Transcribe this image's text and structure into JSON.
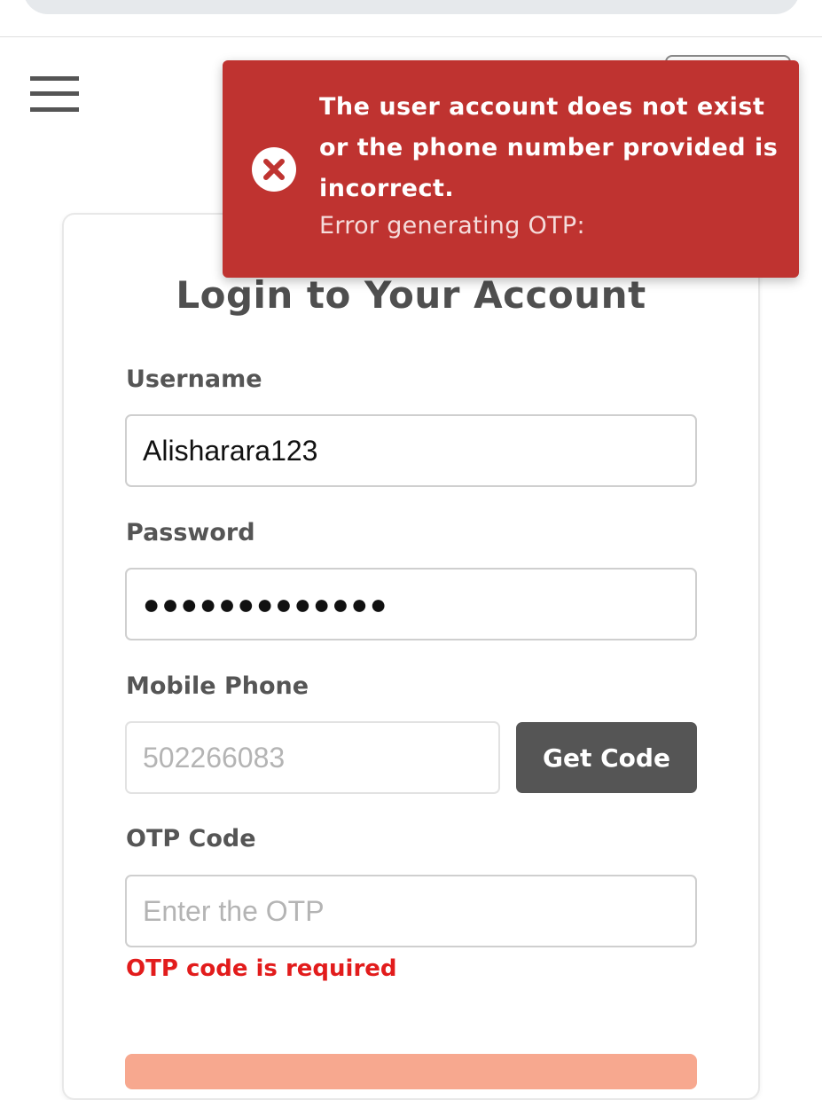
{
  "header": {
    "menu_icon": "hamburger-menu-icon"
  },
  "toast": {
    "type": "error",
    "icon": "error-circle-x-icon",
    "color": "#bf3330",
    "message": "The user account does not exist or the phone number provided is incorrect.",
    "detail": "Error generating OTP:"
  },
  "login": {
    "title": "Login to Your Account",
    "username": {
      "label": "Username",
      "value": "Alisharara123"
    },
    "password": {
      "label": "Password",
      "masked_value": "●●●●●●●●●●●●●"
    },
    "mobile": {
      "label": "Mobile Phone",
      "placeholder": "502266083",
      "get_code_label": "Get Code"
    },
    "otp": {
      "label": "OTP Code",
      "placeholder": "Enter the OTP",
      "error": "OTP code is required"
    },
    "submit_color": "#f7a88f"
  }
}
